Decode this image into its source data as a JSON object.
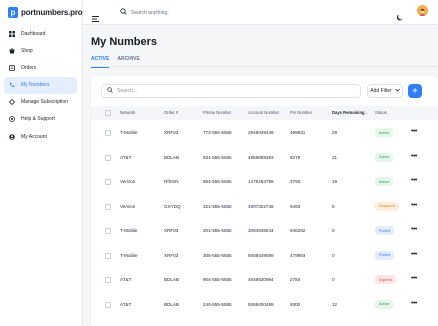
{
  "brand": {
    "logo_letter": "p",
    "name": "portnumbers.pro",
    "accent": "#2f7ff6"
  },
  "sidebar": {
    "items": [
      {
        "label": "Dashboard",
        "icon": "grid-icon",
        "active": false
      },
      {
        "label": "Shop",
        "icon": "shop-icon",
        "active": false
      },
      {
        "label": "Orders",
        "icon": "orders-icon",
        "active": false
      },
      {
        "label": "My Numbers",
        "icon": "phone-icon",
        "active": true
      },
      {
        "label": "Manage Subscription",
        "icon": "subscription-icon",
        "active": false
      },
      {
        "label": "Help & Support",
        "icon": "help-icon",
        "active": false
      },
      {
        "label": "My Account",
        "icon": "account-icon",
        "active": false
      }
    ]
  },
  "topbar": {
    "search_placeholder": "Search anything..",
    "theme_icon": "moon-icon",
    "avatar": "user-avatar"
  },
  "main": {
    "title": "My Numbers",
    "tabs": [
      {
        "label": "ACTIVE",
        "active": true
      },
      {
        "label": "ARCHIVE",
        "active": false
      }
    ],
    "search_placeholder": "Search...",
    "filter_label": "Add Filter",
    "add_label": "+"
  },
  "table": {
    "columns": [
      "Network",
      "Order #",
      "Phone Number",
      "Account Number",
      "Pin Number",
      "Days Remaining ↓",
      "Status"
    ],
    "rows": [
      {
        "network": "T-Mobile",
        "order": "XRF03",
        "phone": "773-555-5555",
        "account": "2948049449",
        "pin": "499931",
        "days": "29",
        "status": "Active"
      },
      {
        "network": "AT&T",
        "order": "BDLAB",
        "phone": "631-555-5555",
        "account": "4958889393",
        "pin": "8279",
        "days": "21",
        "status": "Active"
      },
      {
        "network": "Verizon",
        "order": "RfSON",
        "phone": "954-555-5555",
        "account": "1479494799",
        "pin": "3793",
        "days": "19",
        "status": "Active"
      },
      {
        "network": "Verizon",
        "order": "GXYDQ",
        "phone": "321-555-5555",
        "account": "4997302749",
        "pin": "9493",
        "days": "5",
        "status": "Replaced"
      },
      {
        "network": "T-Mobile",
        "order": "XRF03",
        "phone": "201-555-5555",
        "account": "3094948044",
        "pin": "946282",
        "days": "0",
        "status": "Ported"
      },
      {
        "network": "T-Mobile",
        "order": "XRF03",
        "phone": "305-555-5555",
        "account": "9408449099",
        "pin": "479993",
        "days": "0",
        "status": "Ported"
      },
      {
        "network": "AT&T",
        "order": "BDLAB",
        "phone": "904-555-5555",
        "account": "4846830994",
        "pin": "2784",
        "days": "0",
        "status": "Expired"
      },
      {
        "network": "AT&T",
        "order": "BDLAB",
        "phone": "240-555-5555",
        "account": "9268400489",
        "pin": "9300",
        "days": "12",
        "status": "Active"
      }
    ],
    "row_actions_icon": "more-horizontal-icon"
  },
  "status_colors": {
    "Active": {
      "bg": "#e6f6ea",
      "fg": "#2e9e4f"
    },
    "Replaced": {
      "bg": "#fdeedd",
      "fg": "#e0872c"
    },
    "Ported": {
      "bg": "#e3edfd",
      "fg": "#3b78e7"
    },
    "Expired": {
      "bg": "#fde6e6",
      "fg": "#e04c4c"
    }
  }
}
